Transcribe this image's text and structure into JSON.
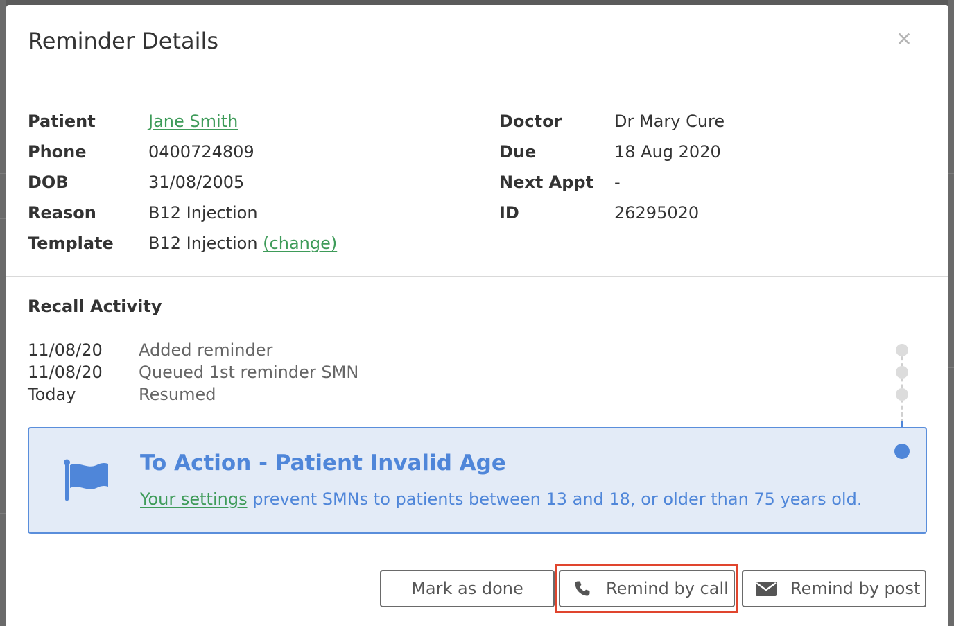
{
  "modal": {
    "title": "Reminder Details"
  },
  "details": {
    "left": [
      {
        "label": "Patient",
        "value": "Jane Smith"
      },
      {
        "label": "Phone",
        "value": "0400724809"
      },
      {
        "label": "DOB",
        "value": "31/08/2005"
      },
      {
        "label": "Reason",
        "value": "B12 Injection"
      },
      {
        "label": "Template",
        "value": "B12 Injection",
        "link": "(change)"
      }
    ],
    "right": [
      {
        "label": "Doctor",
        "value": "Dr Mary Cure"
      },
      {
        "label": "Due",
        "value": "18 Aug 2020"
      },
      {
        "label": "Next Appt",
        "value": "-"
      },
      {
        "label": "ID",
        "value": "26295020"
      }
    ]
  },
  "activity": {
    "title": "Recall Activity",
    "items": [
      {
        "date": "11/08/20",
        "text": "Added reminder"
      },
      {
        "date": "11/08/20",
        "text": "Queued 1st reminder SMN"
      },
      {
        "date": "Today",
        "text": "Resumed"
      }
    ]
  },
  "alert": {
    "icon": "flag-icon",
    "title": "To Action - Patient Invalid Age",
    "link": "Your settings",
    "text": " prevent SMNs to patients between 13 and 18, or older than 75 years old."
  },
  "actions": {
    "mark_done": "Mark as done",
    "remind_call": "Remind by call",
    "remind_post": "Remind by post"
  },
  "colors": {
    "accent": "#4f86d9",
    "link": "#3e9b59",
    "alert_bg": "#e3ebf7",
    "highlight": "#e0452e"
  }
}
